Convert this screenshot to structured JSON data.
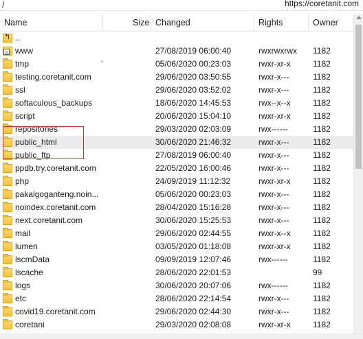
{
  "pathbar": {
    "path": "/",
    "url": "https://coretanit.com"
  },
  "columns": {
    "name": "Name",
    "size": "Size",
    "changed": "Changed",
    "rights": "Rights",
    "owner": "Owner"
  },
  "rows": [
    {
      "name": "..",
      "changed": "",
      "rights": "",
      "owner": "",
      "icon": "parent-directory-icon"
    },
    {
      "name": "www",
      "changed": "27/08/2019 06:00:40",
      "rights": "rwxrwxrwx",
      "owner": "1182",
      "icon": "symlink-folder-icon"
    },
    {
      "name": "tmp",
      "changed": "05/06/2020 00:23:03",
      "rights": "rwxr-xr-x",
      "owner": "1182",
      "icon": "folder-icon"
    },
    {
      "name": "testing.coretanit.com",
      "changed": "29/06/2020 03:50:55",
      "rights": "rwxr-x---",
      "owner": "1182",
      "icon": "folder-icon"
    },
    {
      "name": "ssl",
      "changed": "29/06/2020 03:52:02",
      "rights": "rwxr-x---",
      "owner": "1182",
      "icon": "folder-icon"
    },
    {
      "name": "softaculous_backups",
      "changed": "18/06/2020 14:45:53",
      "rights": "rwx--x--x",
      "owner": "1182",
      "icon": "folder-icon"
    },
    {
      "name": "script",
      "changed": "20/06/2020 15:04:10",
      "rights": "rwxr-xr-x",
      "owner": "1182",
      "icon": "folder-icon"
    },
    {
      "name": "repositories",
      "changed": "29/03/2020 02:03:09",
      "rights": "rwx------",
      "owner": "1182",
      "icon": "folder-icon"
    },
    {
      "name": "public_html",
      "changed": "30/06/2020 21:46:32",
      "rights": "rwxr-x---",
      "owner": "1182",
      "icon": "folder-icon",
      "selected": true
    },
    {
      "name": "public_ftp",
      "changed": "27/08/2019 06:00:40",
      "rights": "rwxr-x---",
      "owner": "1182",
      "icon": "folder-icon"
    },
    {
      "name": "ppdb.try.coretanit.com",
      "changed": "22/05/2020 16:00:46",
      "rights": "rwxr-x---",
      "owner": "1182",
      "icon": "folder-icon"
    },
    {
      "name": "php",
      "changed": "24/09/2019 11:12:32",
      "rights": "rwxr-xr-x",
      "owner": "1182",
      "icon": "folder-icon"
    },
    {
      "name": "pakalgoganteng.noin...",
      "changed": "05/06/2020 00:23:03",
      "rights": "rwxr-x---",
      "owner": "1182",
      "icon": "folder-icon"
    },
    {
      "name": "noindex.coretanit.com",
      "changed": "28/04/2020 15:16:28",
      "rights": "rwxr-x---",
      "owner": "1182",
      "icon": "folder-icon"
    },
    {
      "name": "next.coretanit.com",
      "changed": "30/06/2020 15:25:53",
      "rights": "rwxr-x---",
      "owner": "1182",
      "icon": "folder-icon"
    },
    {
      "name": "mail",
      "changed": "29/06/2020 02:44:55",
      "rights": "rwxr-x--x",
      "owner": "1182",
      "icon": "folder-icon"
    },
    {
      "name": "lumen",
      "changed": "03/05/2020 01:18:08",
      "rights": "rwxr-xr-x",
      "owner": "1182",
      "icon": "folder-icon"
    },
    {
      "name": "lscmData",
      "changed": "09/09/2019 12:07:46",
      "rights": "rwx------",
      "owner": "1182",
      "icon": "folder-icon"
    },
    {
      "name": "lscache",
      "changed": "28/06/2020 22:01:53",
      "rights": "",
      "owner": "99",
      "icon": "folder-icon"
    },
    {
      "name": "logs",
      "changed": "30/06/2020 20:07:06",
      "rights": "rwx------",
      "owner": "1182",
      "icon": "folder-icon"
    },
    {
      "name": "etc",
      "changed": "28/06/2020 22:14:54",
      "rights": "rwxr-x---",
      "owner": "1182",
      "icon": "folder-icon"
    },
    {
      "name": "covid19.coretanit.com",
      "changed": "29/06/2020 02:44:30",
      "rights": "rwxr-x---",
      "owner": "1182",
      "icon": "folder-icon"
    },
    {
      "name": "coretani",
      "changed": "29/03/2020 02:08:08",
      "rights": "rwxr-xr-x",
      "owner": "1182",
      "icon": "folder-icon"
    }
  ],
  "colors": {
    "highlight_box": "#d42b2b",
    "selected_row": "#ececec",
    "folder": "#f2c237"
  }
}
